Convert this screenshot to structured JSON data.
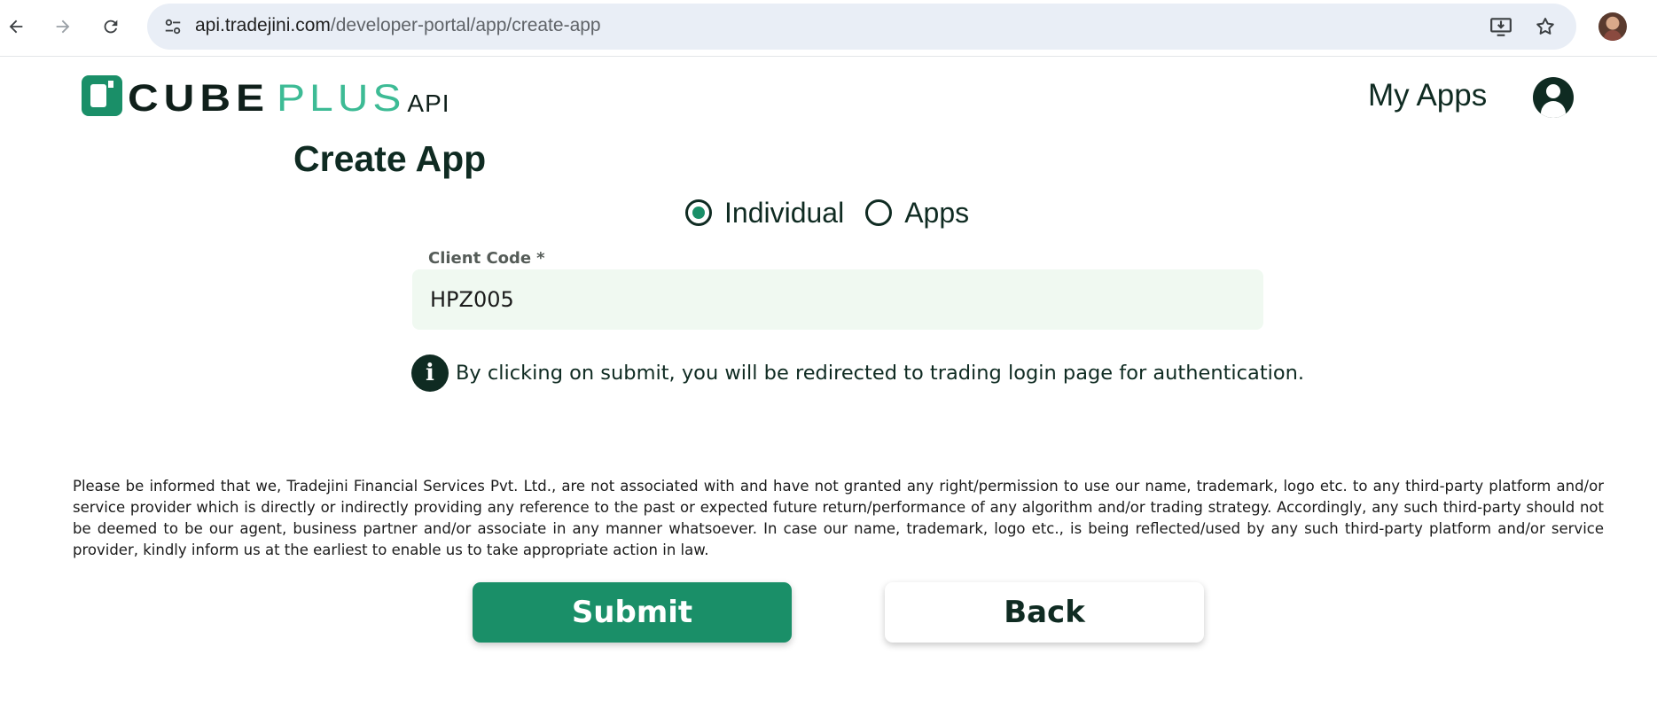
{
  "browser": {
    "url_host": "api.tradejini.com",
    "url_path": "/developer-portal/app/create-app",
    "icons": {
      "back": "arrow-left-icon",
      "forward": "arrow-right-icon",
      "reload": "reload-icon",
      "site_info": "tune-icon",
      "install": "install-app-icon",
      "bookmark": "star-icon",
      "profile": "profile-avatar"
    }
  },
  "header": {
    "logo": {
      "cube": "CUBE",
      "plus": "PLUS",
      "api": "API"
    },
    "my_apps": "My Apps",
    "account_icon": "user-circle-icon"
  },
  "main": {
    "title": "Create App",
    "radio_options": [
      {
        "label": "Individual",
        "checked": true
      },
      {
        "label": "Apps",
        "checked": false
      }
    ],
    "client_code": {
      "label": "Client Code",
      "required_marker": "*",
      "value": "HPZ005"
    },
    "info_text": "By clicking on submit, you will be redirected to trading login page for authentication.",
    "disclaimer": "Please be informed that we, Tradejini Financial Services Pvt. Ltd., are not associated with and have not granted any right/permission to use our name, trademark, logo etc. to any third-party platform and/or service provider which is directly or indirectly providing any reference to the past or expected future return/performance of any algorithm and/or trading strategy. Accordingly, any such third-party should not be deemed to be our agent, business partner and/or associate in any manner whatsoever. In case our name, trademark, logo etc., is being reflected/used by any such third-party platform and/or service provider, kindly inform us at the earliest to enable us to take appropriate action in law.",
    "submit_label": "Submit",
    "back_label": "Back"
  },
  "colors": {
    "brand_green": "#1a8f68",
    "brand_light_green": "#3dbb95",
    "dark_text": "#0f2b22",
    "input_bg": "#f0f9f1"
  }
}
